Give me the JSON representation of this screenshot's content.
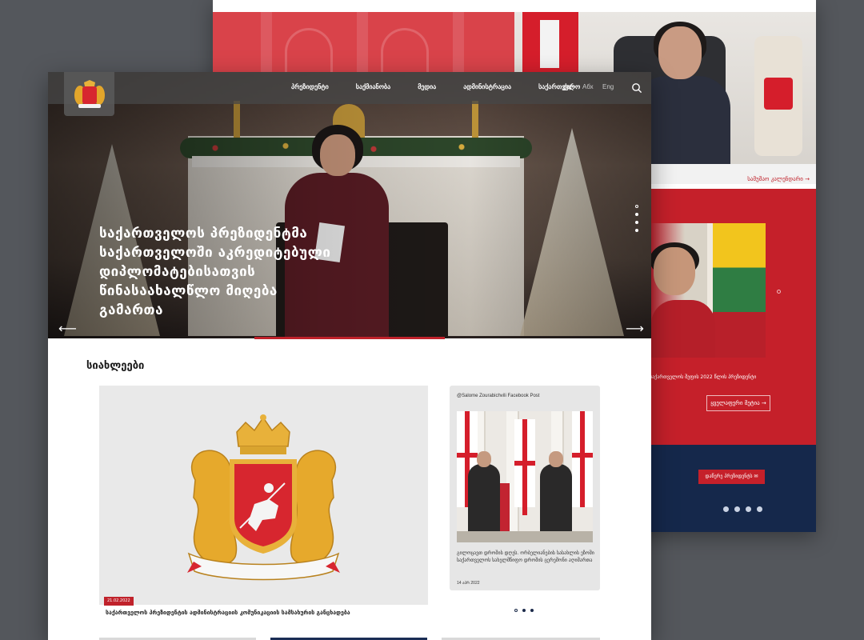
{
  "back_page": {
    "calendar_link": "სამუშაო კალენდარი",
    "red_section_caption": "საქართველოს შეფის 2022 წლის პრეზიდენტი",
    "more_button": "ყველაფერი მეტია",
    "contact_button": "დაწერე პრეზიდენტს",
    "social_icons": [
      "facebook-icon",
      "twitter-icon",
      "instagram-icon",
      "youtube-icon"
    ]
  },
  "nav": {
    "links": [
      "პრეზიდენტი",
      "საქმიანობა",
      "მედია",
      "ადმინისტრაცია",
      "საქართველო"
    ],
    "languages": [
      "ქარ",
      "Абх",
      "Eng"
    ],
    "active_language": "ქარ"
  },
  "hero": {
    "title": "საქართველოს პრეზიდენტმა საქართველოში აკრედიტებული დიპლომატებისათვის წინასაახალწლო მიღება გამართა",
    "prev_arrow": "⟵",
    "next_arrow": "⟶",
    "slide_count": 4,
    "active_slide": 2
  },
  "news": {
    "section_title": "სიახლეები",
    "main_date": "21.02.2022",
    "main_caption": "საქართველოს პრეზიდენტის ადმინისტრაციის კომუნიკაციის სამსახურის განცხადება",
    "facebook_card": {
      "label": "@Salome Zourabichvili Facebook Post",
      "text": "გილოცავთ დროშის დღეს. ორბელიანების სასახლის ეზოში საქართველოს სახელმწიფო დროშის ცერემონი აღიმართა",
      "date": "14 აპრ 2022"
    },
    "slider_dots": 3,
    "active_dot": 0
  },
  "colors": {
    "brand_red": "#c0222b",
    "navy": "#15284b",
    "nav_bg": "#464646"
  }
}
